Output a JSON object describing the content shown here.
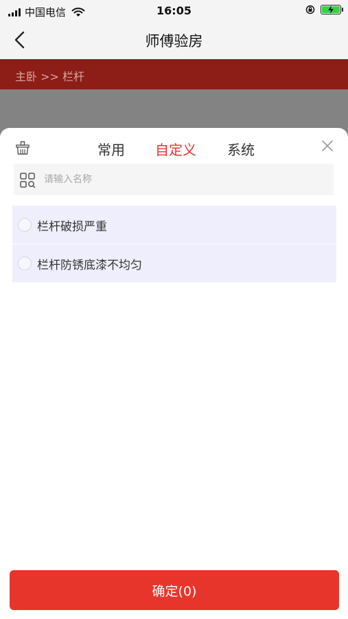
{
  "status_bar": {
    "carrier": "中国电信",
    "time": "16:05"
  },
  "nav": {
    "title": "师傅验房"
  },
  "breadcrumb": {
    "text": "主卧 >> 栏杆"
  },
  "sheet": {
    "tabs": [
      {
        "label": "常用",
        "active": false
      },
      {
        "label": "自定义",
        "active": true
      },
      {
        "label": "系统",
        "active": false
      }
    ],
    "search": {
      "placeholder": "请输入名称",
      "value": ""
    },
    "items": [
      {
        "label": "栏杆破损严重",
        "selected": false
      },
      {
        "label": "栏杆防锈底漆不均匀",
        "selected": false
      }
    ],
    "confirm_label": "确定(0)"
  },
  "colors": {
    "accent": "#e8352b",
    "breadcrumb_bg": "#8c1d17",
    "list_bg": "#eeeefc",
    "battery": "#3ecf4a"
  },
  "icons": {
    "back": "chevron-left-icon",
    "basket": "basket-icon",
    "close": "close-icon",
    "grid": "grid-search-icon"
  }
}
